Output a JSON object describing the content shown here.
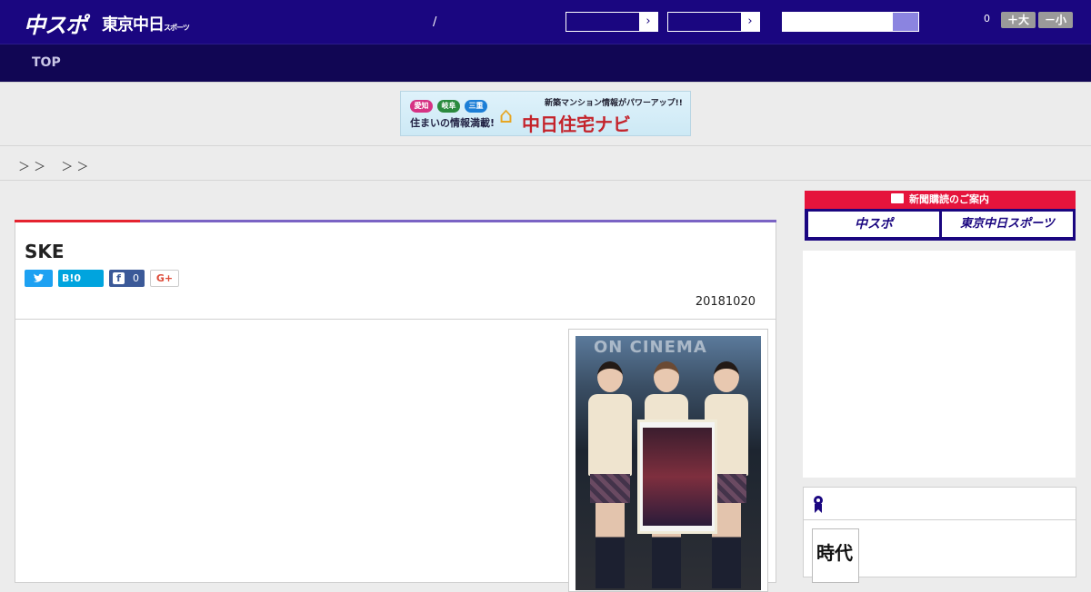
{
  "header": {
    "logo_chuspo": "中スポ",
    "logo_tokyo": "東京中日",
    "logo_tokyo_small": "スポーツ",
    "slash": "/",
    "select1_arrow": "›",
    "select2_arrow": "›",
    "count": "0",
    "font_up": "＋大",
    "font_down": "－小"
  },
  "nav": {
    "top": "TOP"
  },
  "banner": {
    "pill1": "愛知",
    "pill2": "岐阜",
    "pill3": "三重",
    "text_left": "住まいの情報満載!",
    "text_top": "新築マンション情報がパワーアップ!!",
    "brand": "中日住宅ナビ"
  },
  "breadcrumb": "＞ ＞ 　＞ ＞",
  "article": {
    "title": "SKE",
    "share_twitter": "",
    "share_hatena": "B!0",
    "share_facebook": "0",
    "share_google": "G+",
    "date": "20181020"
  },
  "photo": {
    "sign": "ON CINEMA"
  },
  "sidebar": {
    "subscribe_header": "新聞購読のご案内",
    "subscribe_chuspo": "中スポ",
    "subscribe_tokyo": "東京中日スポーツ",
    "book_text": "時代"
  },
  "colors": {
    "header_bg": "#1a0680",
    "nav_bg": "#110654",
    "accent_red": "#e5232f",
    "accent_purple": "#7a63c4"
  }
}
